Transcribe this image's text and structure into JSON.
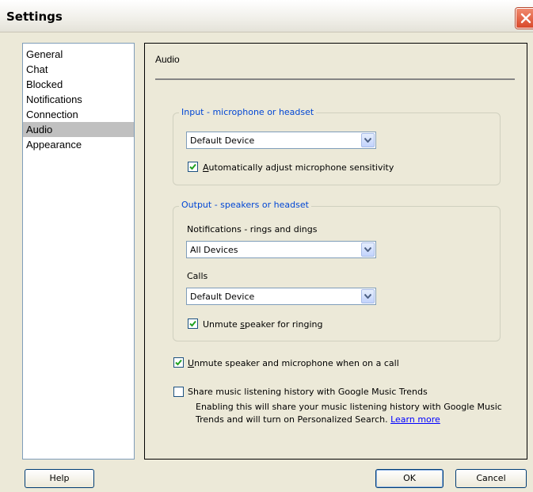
{
  "window": {
    "title": "Settings"
  },
  "sidebar": {
    "items": [
      {
        "label": "General"
      },
      {
        "label": "Chat"
      },
      {
        "label": "Blocked"
      },
      {
        "label": "Notifications"
      },
      {
        "label": "Connection"
      },
      {
        "label": "Audio",
        "selected": true
      },
      {
        "label": "Appearance"
      }
    ]
  },
  "panel": {
    "heading": "Audio",
    "input_group": {
      "title": "Input - microphone or headset",
      "device": "Default Device",
      "auto_adjust": {
        "label_underlined_char": "A",
        "label_rest": "utomatically adjust microphone sensitivity",
        "checked": true
      }
    },
    "output_group": {
      "title": "Output - speakers or headset",
      "notifications_label": "Notifications - rings and dings",
      "notifications_device": "All Devices",
      "calls_label": "Calls",
      "calls_device": "Default Device",
      "unmute_ringing": {
        "label_before": "Unmute ",
        "label_underlined_char": "s",
        "label_after": "peaker for ringing",
        "checked": true
      }
    },
    "unmute_on_call": {
      "label_underlined_char": "U",
      "label_rest": "nmute speaker and microphone when on a call",
      "checked": true
    },
    "share_music": {
      "label": "Share music listening history with Google Music Trends",
      "checked": false,
      "description_line1": "Enabling this will share your music listening history with Google Music",
      "description_line2": "Trends and will turn on Personalized Search.",
      "learn_more": "Learn more"
    }
  },
  "buttons": {
    "help": "Help",
    "ok": "OK",
    "cancel": "Cancel"
  },
  "colors": {
    "group_title": "#0046d5",
    "selected_item": "#c0c0c0",
    "link": "#0000ff"
  },
  "icons": {
    "close": "close-icon",
    "dropdown": "chevron-down-icon",
    "check": "checkmark-icon"
  }
}
